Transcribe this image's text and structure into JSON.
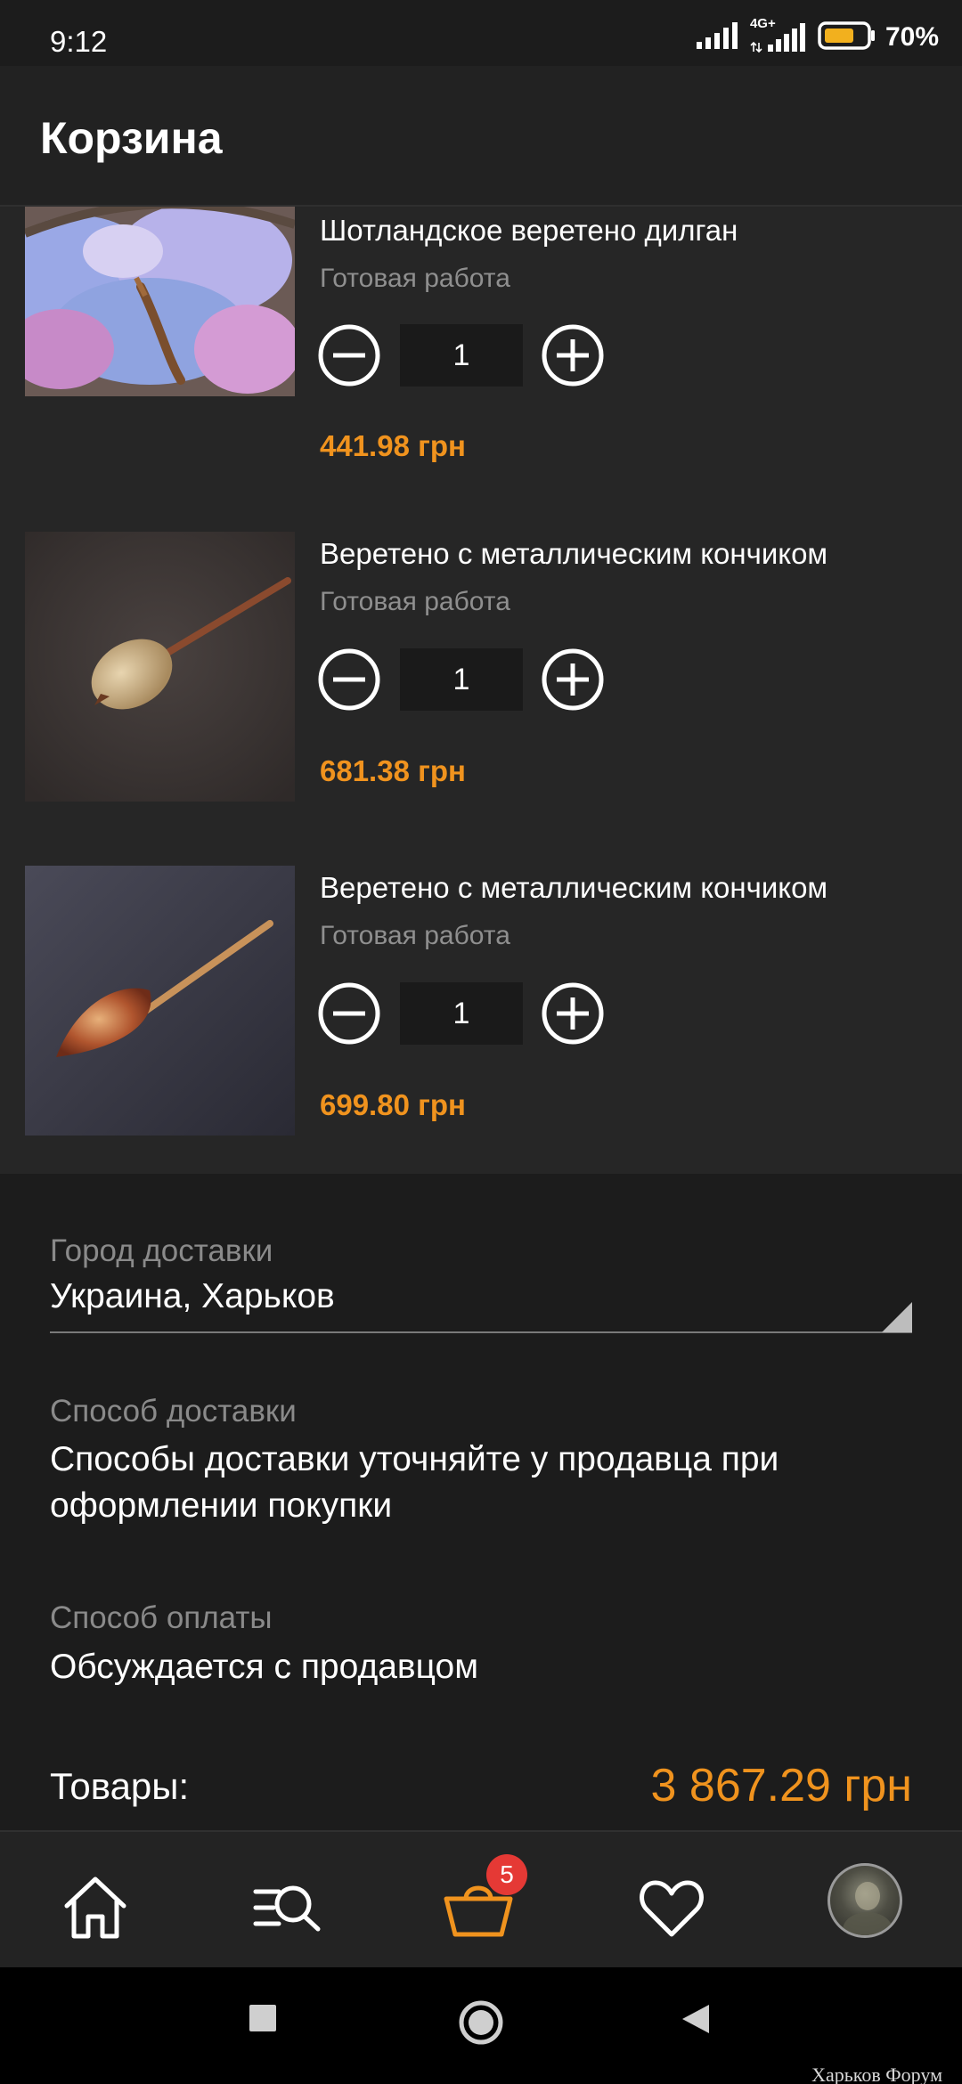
{
  "status_bar": {
    "time": "9:12",
    "network": "4G+",
    "battery": "70%"
  },
  "header": {
    "title": "Корзина"
  },
  "cart": {
    "items": [
      {
        "title": "Шотландское веретено дилган",
        "subtitle": "Готовая работа",
        "quantity": "1",
        "price": "441.98 грн",
        "image_icon": "wool-spindle-photo"
      },
      {
        "title": "Веретено с металлическим кончиком",
        "subtitle": "Готовая работа",
        "quantity": "1",
        "price": "681.38 грн",
        "image_icon": "spindle-photo"
      },
      {
        "title": "Веретено с металлическим кончиком",
        "subtitle": "Готовая работа",
        "quantity": "1",
        "price": "699.80 грн",
        "image_icon": "spindle-photo"
      }
    ]
  },
  "delivery": {
    "city_label": "Город доставки",
    "city_value": "Украина, Харьков",
    "method_label": "Способ доставки",
    "method_value": "Способы доставки уточняйте у продавца при оформлении покупки",
    "payment_label": "Способ оплаты",
    "payment_value": "Обсуждается с продавцом"
  },
  "totals": {
    "label": "Товары:",
    "value": "3 867.29 грн"
  },
  "bottom_nav": {
    "cart_badge": "5",
    "items": [
      "home-icon",
      "catalog-search-icon",
      "cart-icon",
      "heart-icon",
      "avatar"
    ]
  },
  "watermark": "Харьков Форум",
  "colors": {
    "accent": "#f0931e",
    "badge": "#e53935",
    "background": "#1c1c1c",
    "list_background": "#262626"
  }
}
